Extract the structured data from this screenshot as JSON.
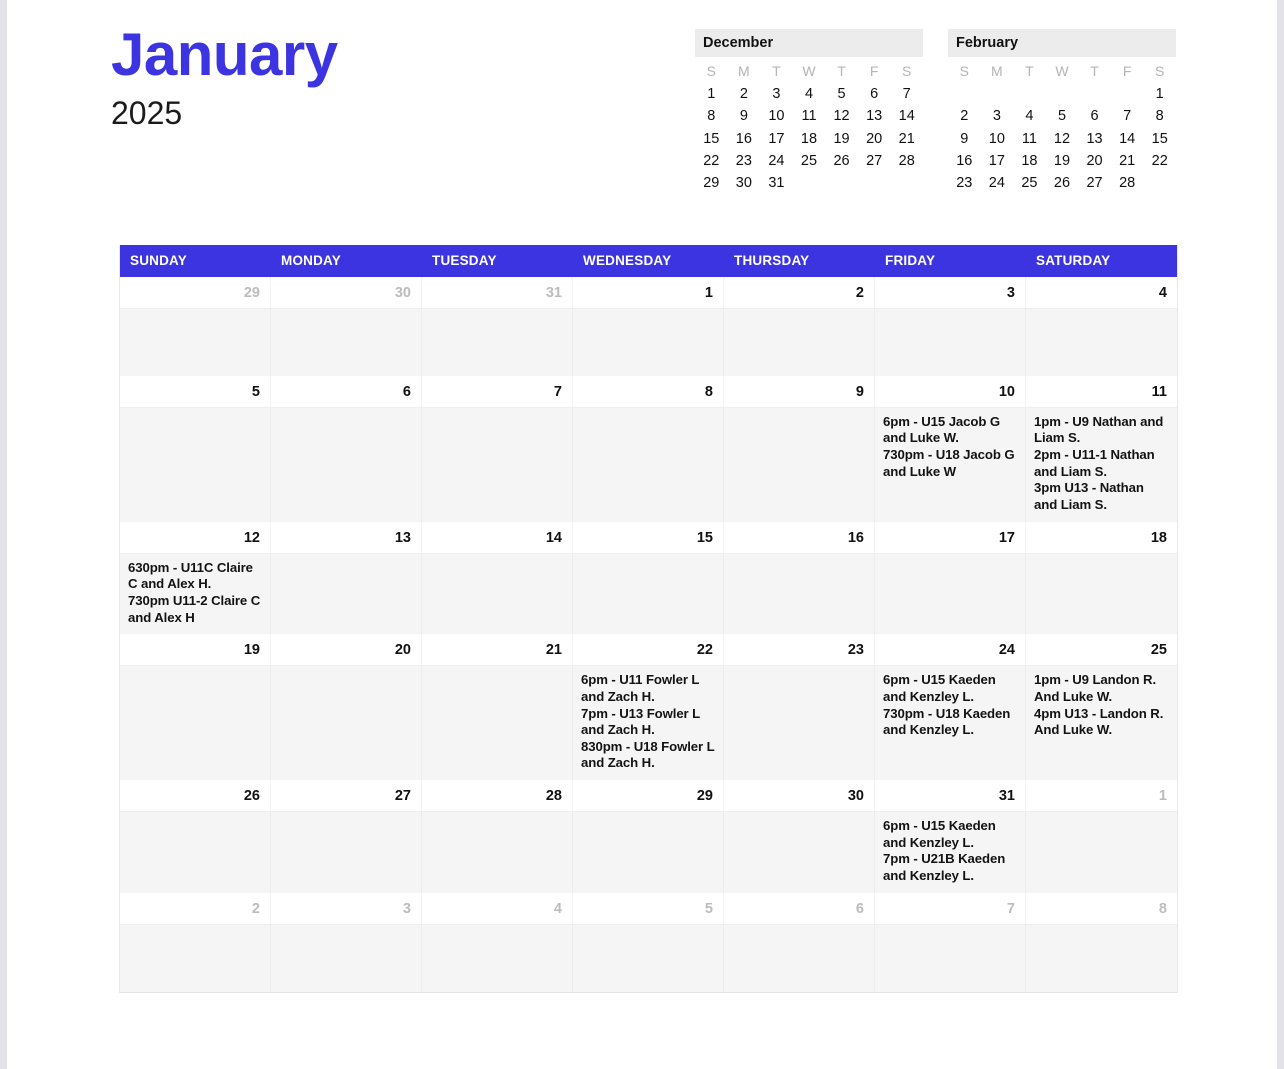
{
  "header": {
    "month_title": "January",
    "year_title": "2025",
    "mini_calendars": [
      {
        "name": "prev-month",
        "title": "December",
        "dow": [
          "S",
          "M",
          "T",
          "W",
          "T",
          "F",
          "S"
        ],
        "lead_blanks": 0,
        "days": [
          1,
          2,
          3,
          4,
          5,
          6,
          7,
          8,
          9,
          10,
          11,
          12,
          13,
          14,
          15,
          16,
          17,
          18,
          19,
          20,
          21,
          22,
          23,
          24,
          25,
          26,
          27,
          28,
          29,
          30,
          31
        ]
      },
      {
        "name": "next-month",
        "title": "February",
        "dow": [
          "S",
          "M",
          "T",
          "W",
          "T",
          "F",
          "S"
        ],
        "lead_blanks": 6,
        "days": [
          1,
          2,
          3,
          4,
          5,
          6,
          7,
          8,
          9,
          10,
          11,
          12,
          13,
          14,
          15,
          16,
          17,
          18,
          19,
          20,
          21,
          22,
          23,
          24,
          25,
          26,
          27,
          28
        ]
      }
    ]
  },
  "calendar": {
    "day_headers": [
      "SUNDAY",
      "MONDAY",
      "TUESDAY",
      "WEDNESDAY",
      "THURSDAY",
      "FRIDAY",
      "SATURDAY"
    ],
    "accent_color": "#3c34e0",
    "weeks": [
      {
        "days": [
          {
            "num": "29",
            "out": true,
            "events": []
          },
          {
            "num": "30",
            "out": true,
            "events": []
          },
          {
            "num": "31",
            "out": true,
            "events": []
          },
          {
            "num": "1",
            "out": false,
            "events": []
          },
          {
            "num": "2",
            "out": false,
            "events": []
          },
          {
            "num": "3",
            "out": false,
            "events": []
          },
          {
            "num": "4",
            "out": false,
            "events": []
          }
        ]
      },
      {
        "days": [
          {
            "num": "5",
            "out": false,
            "events": []
          },
          {
            "num": "6",
            "out": false,
            "events": []
          },
          {
            "num": "7",
            "out": false,
            "events": []
          },
          {
            "num": "8",
            "out": false,
            "events": []
          },
          {
            "num": "9",
            "out": false,
            "events": []
          },
          {
            "num": "10",
            "out": false,
            "events": [
              "6pm - U15 Jacob G and Luke W.",
              "730pm - U18 Jacob G and Luke W"
            ]
          },
          {
            "num": "11",
            "out": false,
            "events": [
              "1pm - U9 Nathan and Liam S.",
              "2pm - U11-1 Nathan and Liam S.",
              "3pm U13 - Nathan and Liam S."
            ]
          }
        ]
      },
      {
        "days": [
          {
            "num": "12",
            "out": false,
            "events": [
              "630pm - U11C Claire C and Alex H.",
              "730pm U11-2 Claire C and Alex H"
            ]
          },
          {
            "num": "13",
            "out": false,
            "events": []
          },
          {
            "num": "14",
            "out": false,
            "events": []
          },
          {
            "num": "15",
            "out": false,
            "events": []
          },
          {
            "num": "16",
            "out": false,
            "events": []
          },
          {
            "num": "17",
            "out": false,
            "events": []
          },
          {
            "num": "18",
            "out": false,
            "events": []
          }
        ]
      },
      {
        "days": [
          {
            "num": "19",
            "out": false,
            "events": []
          },
          {
            "num": "20",
            "out": false,
            "events": []
          },
          {
            "num": "21",
            "out": false,
            "events": []
          },
          {
            "num": "22",
            "out": false,
            "events": [
              "6pm - U11 Fowler L and Zach H.",
              "7pm - U13 Fowler L and Zach H.",
              "830pm - U18 Fowler L and Zach H."
            ]
          },
          {
            "num": "23",
            "out": false,
            "events": []
          },
          {
            "num": "24",
            "out": false,
            "events": [
              "6pm - U15 Kaeden and Kenzley L.",
              "730pm - U18 Kaeden and Kenzley L."
            ]
          },
          {
            "num": "25",
            "out": false,
            "events": [
              "1pm - U9 Landon R. And Luke W.",
              "4pm U13 - Landon R. And Luke W."
            ]
          }
        ]
      },
      {
        "days": [
          {
            "num": "26",
            "out": false,
            "events": []
          },
          {
            "num": "27",
            "out": false,
            "events": []
          },
          {
            "num": "28",
            "out": false,
            "events": []
          },
          {
            "num": "29",
            "out": false,
            "events": []
          },
          {
            "num": "30",
            "out": false,
            "events": []
          },
          {
            "num": "31",
            "out": false,
            "events": [
              "6pm - U15 Kaeden and Kenzley L.",
              "7pm - U21B Kaeden and Kenzley L."
            ]
          },
          {
            "num": "1",
            "out": true,
            "events": []
          }
        ]
      },
      {
        "days": [
          {
            "num": "2",
            "out": true,
            "events": []
          },
          {
            "num": "3",
            "out": true,
            "events": []
          },
          {
            "num": "4",
            "out": true,
            "events": []
          },
          {
            "num": "5",
            "out": true,
            "events": []
          },
          {
            "num": "6",
            "out": true,
            "events": []
          },
          {
            "num": "7",
            "out": true,
            "events": []
          },
          {
            "num": "8",
            "out": true,
            "events": []
          }
        ]
      }
    ]
  }
}
